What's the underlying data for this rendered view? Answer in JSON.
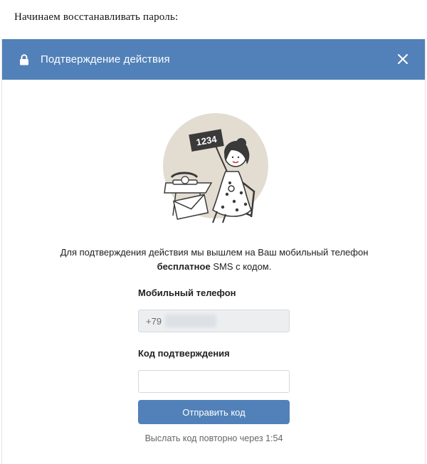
{
  "caption": "Начинаем восстанавливать пароль:",
  "modal": {
    "title": "Подтверждение действия",
    "header_color": "#5181b8",
    "icons": {
      "lock": "lock-icon",
      "close": "close-icon"
    },
    "illustration": {
      "card_text": "1234"
    },
    "info": {
      "line1": "Для подтверждения действия мы вышлем на Ваш мобильный телефон",
      "bold": "бесплатное",
      "rest": " SMS с кодом."
    },
    "phone_field": {
      "label": "Мобильный телефон",
      "value": "+79"
    },
    "code_field": {
      "label": "Код подтверждения",
      "value": ""
    },
    "submit_label": "Отправить код",
    "resend_text": "Выслать код повторно через 1:54"
  }
}
